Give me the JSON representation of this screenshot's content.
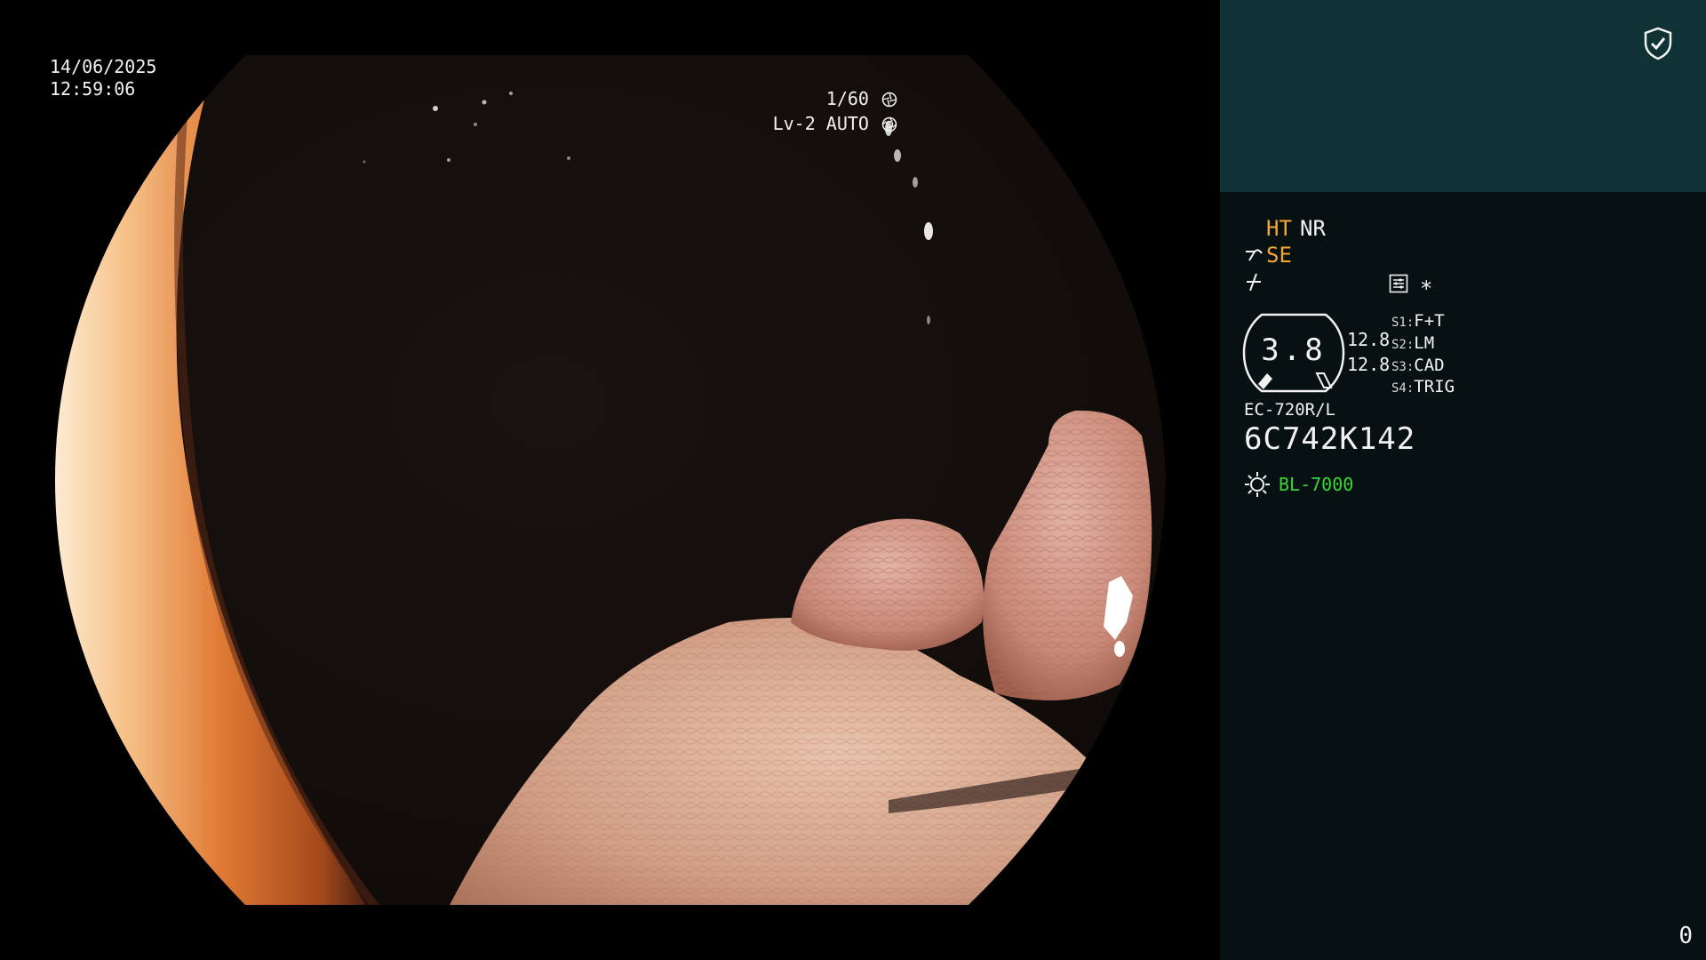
{
  "video": {
    "date": "14/06/2025",
    "time": "12:59:06",
    "shutter": "1/60",
    "shutter_icon": "aperture-icon",
    "level": "Lv-2 AUTO",
    "level_icon": "iris-icon"
  },
  "panel": {
    "header_icon": "shield-check-icon",
    "ht": "HT",
    "nr": "NR",
    "se": "SE",
    "star": "∗",
    "zoom": "3.8",
    "value_top": "12.8",
    "value_bottom": "12.8",
    "switches": [
      {
        "key": "S1:",
        "value": "F+T"
      },
      {
        "key": "S2:",
        "value": "LM"
      },
      {
        "key": "S3:",
        "value": "CAD"
      },
      {
        "key": "S4:",
        "value": "TRIG"
      }
    ],
    "scope_model": "EC-720R/L",
    "scope_serial": "6C742K142",
    "light_source": "BL-7000",
    "counter": "0"
  },
  "colors": {
    "panel_bg": "#071112",
    "header_bg": "#0f3234",
    "accent_orange": "#f5a735",
    "accent_green": "#37d737"
  }
}
